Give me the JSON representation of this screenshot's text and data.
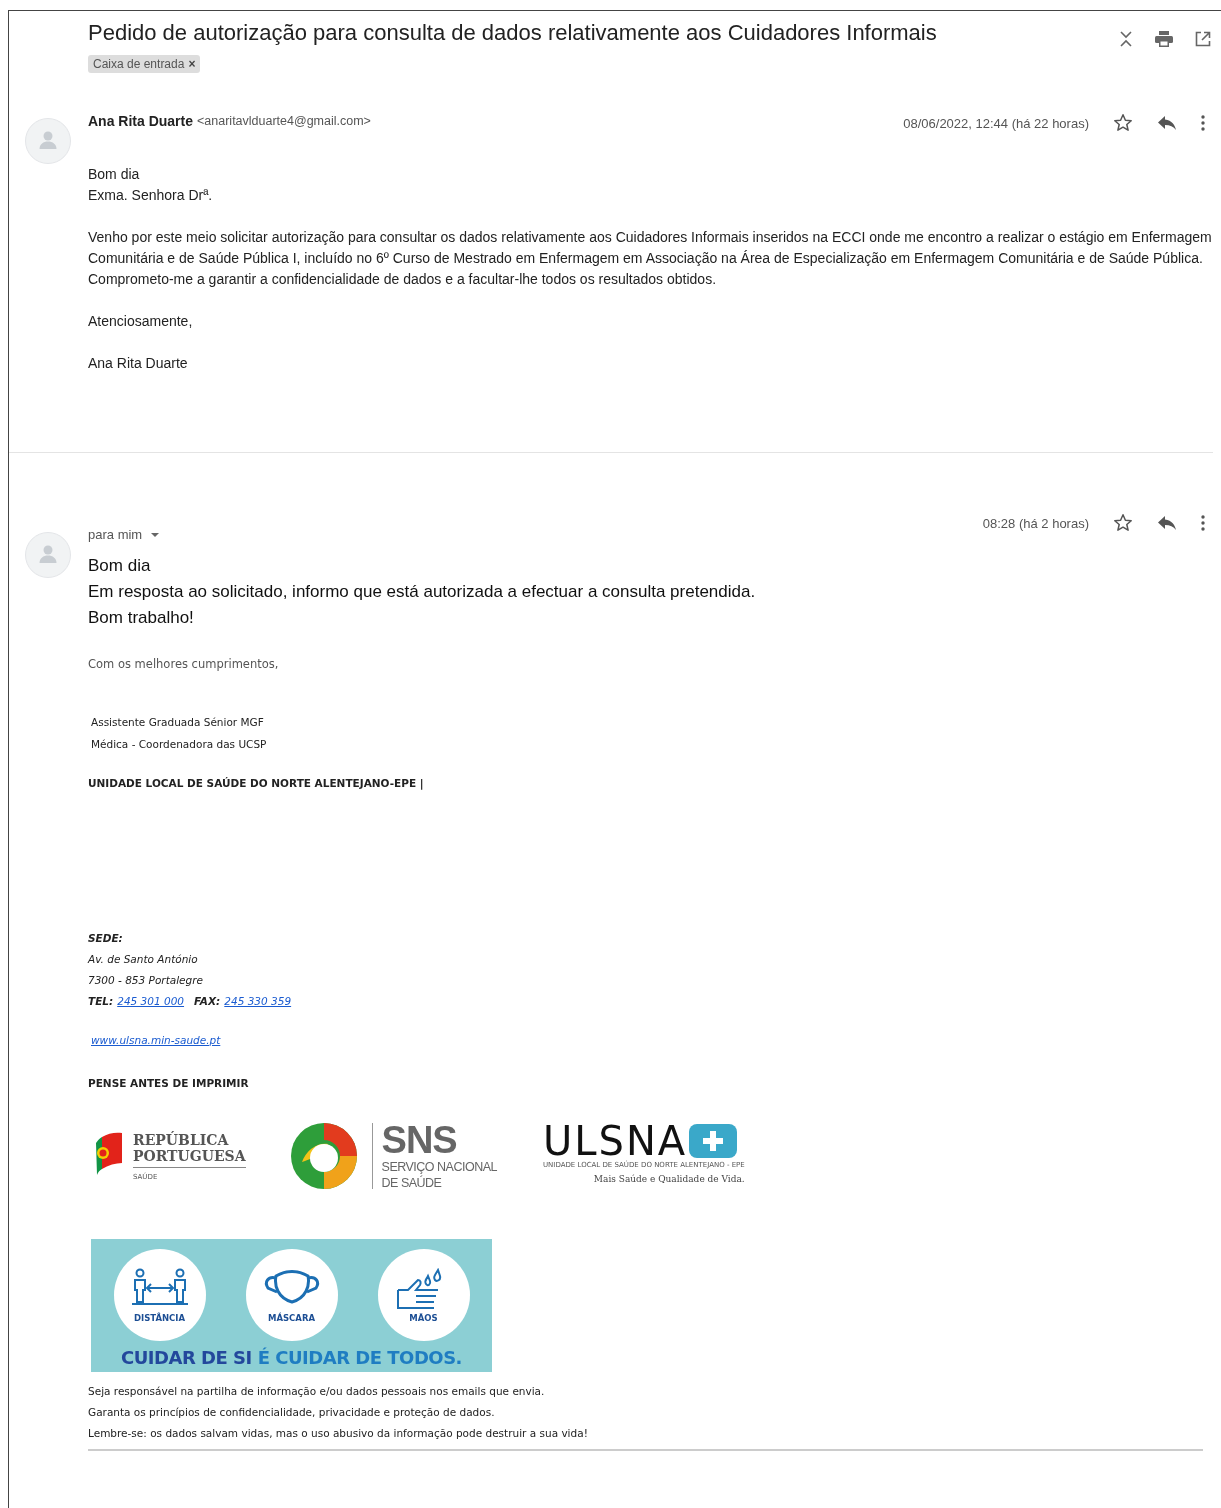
{
  "subject": "Pedido de autorização para consulta de dados relativamente aos Cuidadores Informais",
  "labels": [
    {
      "text": "Caixa de entrada",
      "remove": "×"
    }
  ],
  "messages": [
    {
      "from": {
        "name": "Ana Rita Duarte",
        "email": "<anaritavlduarte4@gmail.com>"
      },
      "date": "08/06/2022, 12:44 (há 22 horas)",
      "starred": false,
      "body": [
        [
          "Bom dia",
          "Exma. Senhora Drª."
        ],
        [
          "Venho por este meio solicitar autorização para consultar os dados relativamente aos Cuidadores Informais inseridos na ECCI onde me encontro a realizar o estágio em Enfermagem Comunitária e de Saúde Pública I, incluído no 6º Curso de Mestrado em Enfermagem em Associação na Área de Especialização em Enfermagem Comunitária e de Saúde Pública.",
          "Comprometo-me a garantir a confidencialidade de dados e a facultar-lhe todos os resultados obtidos."
        ],
        [
          "Atenciosamente,"
        ],
        [
          "Ana Rita Duarte"
        ]
      ]
    },
    {
      "recipient": "para mim",
      "date": "08:28 (há 2 horas)",
      "starred": false,
      "body": [
        "Bom dia",
        "Em resposta ao solicitado, informo que está autorizada a efectuar a consulta pretendida.",
        "Bom trabalho!"
      ],
      "signature": {
        "closing": "Com os melhores cumprimentos,",
        "titles": [
          "Assistente Graduada Sénior MGF",
          "Médica - Coordenadora das UCSP"
        ],
        "organization": "UNIDADE LOCAL DE SAÚDE DO NORTE ALENTEJANO-EPE |",
        "address": {
          "heading": "SEDE:",
          "lines": [
            "Av. de Santo António",
            "7300 - 853 Portalegre"
          ],
          "tel_label": "TEL:",
          "tel": "245 301 000",
          "fax_label": "FAX:",
          "fax": "245 330 359"
        },
        "website": "www.ulsna.min-saude.pt",
        "print_notice": "PENSE ANTES DE IMPRIMIR",
        "logos": [
          {
            "kind": "republica",
            "lines": [
              "REPÚBLICA",
              "PORTUGUESA"
            ],
            "sub": "SAÚDE"
          },
          {
            "kind": "sns",
            "title": "SNS",
            "lines": [
              "SERVIÇO NACIONAL",
              "DE SAÚDE"
            ]
          },
          {
            "kind": "ulsna",
            "title": "ULSNA",
            "sub": "UNIDADE LOCAL DE SAÚDE DO NORTE ALENTEJANO - EPE",
            "tagline": "Mais Saúde e Qualidade de Vida."
          }
        ],
        "banner": {
          "items": [
            {
              "kind": "distance",
              "label": "DISTÂNCIA"
            },
            {
              "kind": "mask",
              "label": "MÁSCARA"
            },
            {
              "kind": "hands",
              "label": "MÃOS"
            }
          ],
          "slogan": [
            "CUIDAR DE SI",
            "É CUIDAR DE TODOS."
          ]
        },
        "disclaimer": [
          "Seja responsável na partilha de informação e/ou dados pessoais nos emails que envia.",
          "Garanta os princípios de confidencialidade, privacidade e proteção de dados.",
          "Lembre-se: os dados salvam vidas, mas o uso abusivo da informação pode destruir a sua vida!"
        ]
      }
    }
  ]
}
